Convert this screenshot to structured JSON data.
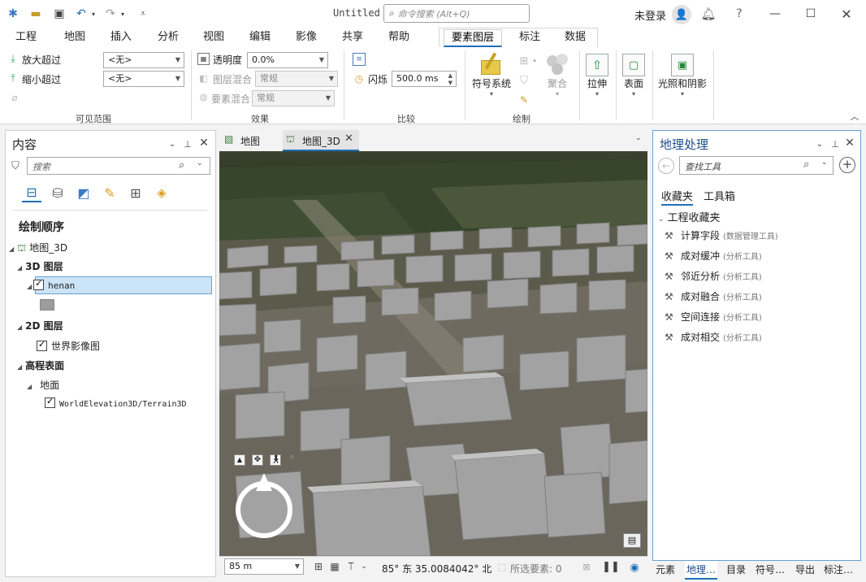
{
  "window": {
    "title": "Untitled",
    "search_placeholder": "命令搜索 (Alt+Q)",
    "login": "未登录"
  },
  "ribbon_tabs": [
    "工程",
    "地图",
    "插入",
    "分析",
    "视图",
    "编辑",
    "影像",
    "共享",
    "帮助",
    "要素图层",
    "标注",
    "数据"
  ],
  "ribbon": {
    "visible_range": {
      "zoom_in_beyond": "放大超过",
      "zoom_out_beyond": "缩小超过",
      "zoom_in_value": "<无>",
      "zoom_out_value": "<无>",
      "caption": "可见范围"
    },
    "effects": {
      "transparency_label": "透明度",
      "transparency_value": "0.0%",
      "layer_blend_label": "图层混合",
      "layer_blend_value": "常规",
      "feature_blend_label": "要素混合",
      "feature_blend_value": "常规",
      "caption": "效果"
    },
    "compare": {
      "flicker_label": "闪烁",
      "flicker_value": "500.0 ms",
      "caption": "比较"
    },
    "drawing": {
      "symbology": "符号系统",
      "aggregation": "聚合",
      "caption": "绘制"
    },
    "extrude": "拉伸",
    "surface": "表面",
    "illumination": "光照和阴影"
  },
  "contents": {
    "title": "内容",
    "search_placeholder": "搜索",
    "drawing_order": "绘制顺序",
    "map_name": "地图_3D",
    "group_3d": "3D 图层",
    "layer_henan": "henan",
    "group_2d": "2D 图层",
    "layer_imagery": "世界影像图",
    "group_elevation": "高程表面",
    "ground": "地面",
    "layer_terrain": "WorldElevation3D/Terrain3D"
  },
  "map_tabs": [
    "地图",
    "地图_3D"
  ],
  "map_status": {
    "scale": "85 m",
    "coords": "85° 东 35.0084042° 北",
    "selected": "所选要素: 0"
  },
  "geoprocessing": {
    "title": "地理处理",
    "search_placeholder": "查找工具",
    "tab_favorites": "收藏夹",
    "tab_toolboxes": "工具箱",
    "project_favorites": "工程收藏夹",
    "tools": [
      {
        "name": "计算字段",
        "box": "(数据管理工具)"
      },
      {
        "name": "成对缓冲",
        "box": "(分析工具)"
      },
      {
        "name": "邻近分析",
        "box": "(分析工具)"
      },
      {
        "name": "成对融合",
        "box": "(分析工具)"
      },
      {
        "name": "空间连接",
        "box": "(分析工具)"
      },
      {
        "name": "成对相交",
        "box": "(分析工具)"
      }
    ]
  },
  "bottom_tabs": [
    "元素",
    "地理…",
    "目录",
    "符号…",
    "导出",
    "标注…"
  ],
  "colors": {
    "accent": "#1e6fb8",
    "selected_row": "#cce4f7",
    "building": "#9c9c9c"
  }
}
